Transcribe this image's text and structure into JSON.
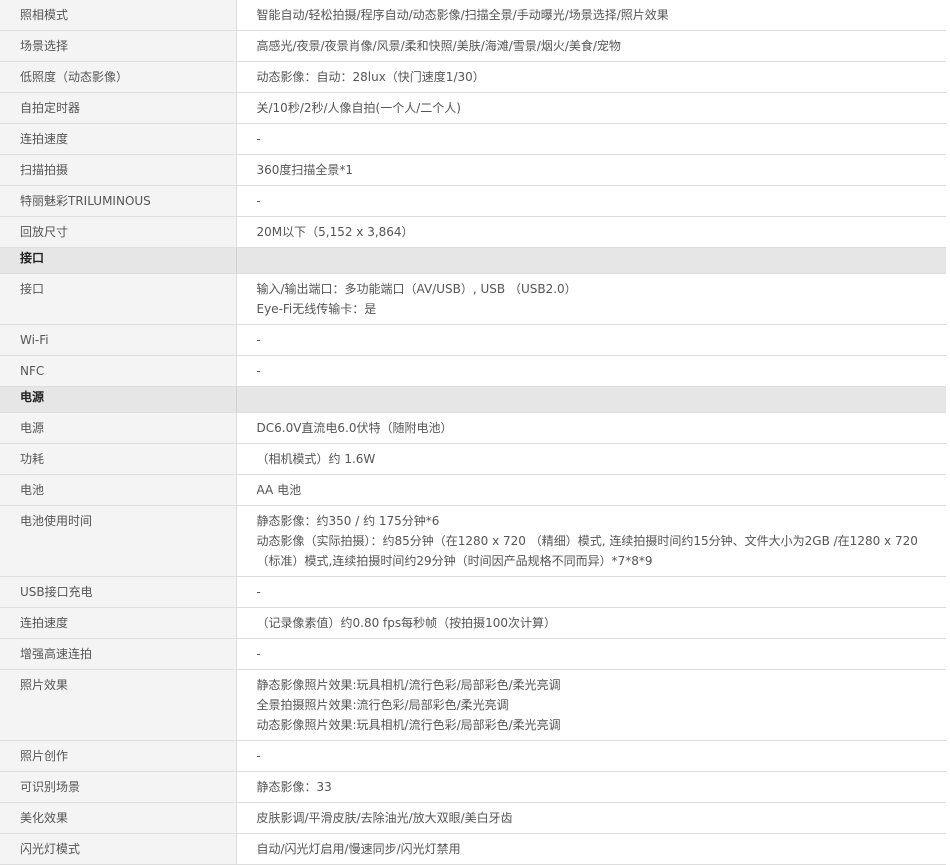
{
  "rows": [
    {
      "type": "row",
      "label": "照相模式",
      "values": [
        "智能自动/轻松拍摄/程序自动/动态影像/扫描全景/手动曝光/场景选择/照片效果"
      ]
    },
    {
      "type": "row",
      "label": "场景选择",
      "values": [
        "高感光/夜景/夜景肖像/风景/柔和快照/美肤/海滩/雪景/烟火/美食/宠物"
      ]
    },
    {
      "type": "row",
      "label": "低照度（动态影像）",
      "values": [
        "动态影像：自动：28lux（快门速度1/30）"
      ]
    },
    {
      "type": "row",
      "label": "自拍定时器",
      "values": [
        "关/10秒/2秒/人像自拍(一个人/二个人)"
      ]
    },
    {
      "type": "row",
      "label": "连拍速度",
      "values": [
        "-"
      ]
    },
    {
      "type": "row",
      "label": "扫描拍摄",
      "values": [
        "360度扫描全景*1"
      ]
    },
    {
      "type": "row",
      "label": "特丽魅彩TRILUMINOUS",
      "values": [
        "-"
      ]
    },
    {
      "type": "row",
      "label": "回放尺寸",
      "values": [
        "20M以下（5,152 x 3,864）"
      ]
    },
    {
      "type": "section",
      "label": "接口"
    },
    {
      "type": "row",
      "label": "接口",
      "values": [
        "输入/输出端口：多功能端口（AV/USB）, USB （USB2.0）",
        "Eye-Fi无线传输卡：是"
      ]
    },
    {
      "type": "row",
      "label": "Wi-Fi",
      "values": [
        "-"
      ]
    },
    {
      "type": "row",
      "label": "NFC",
      "values": [
        "-"
      ]
    },
    {
      "type": "section",
      "label": "电源"
    },
    {
      "type": "row",
      "label": "电源",
      "values": [
        "DC6.0V直流电6.0伏特（随附电池）"
      ]
    },
    {
      "type": "row",
      "label": "功耗",
      "values": [
        "（相机模式）约 1.6W"
      ]
    },
    {
      "type": "row",
      "label": "电池",
      "values": [
        "AA 电池"
      ]
    },
    {
      "type": "row",
      "label": "电池使用时间",
      "values": [
        "静态影像：约350 / 约 175分钟*6",
        "动态影像（实际拍摄）：约85分钟（在1280 x 720 （精细）模式, 连续拍摄时间约15分钟、文件大小为2GB /在1280 x  720",
        "（标准）模式,连续拍摄时间约29分钟（时间因产品规格不同而异）*7*8*9"
      ]
    },
    {
      "type": "row",
      "label": "USB接口充电",
      "values": [
        "-"
      ]
    },
    {
      "type": "row",
      "label": "连拍速度",
      "values": [
        "（记录像素值）约0.80 fps每秒帧（按拍摄100次计算）"
      ]
    },
    {
      "type": "row",
      "label": "增强高速连拍",
      "values": [
        "-"
      ]
    },
    {
      "type": "row",
      "label": "照片效果",
      "values": [
        "静态影像照片效果:玩具相机/流行色彩/局部彩色/柔光亮调",
        "全景拍摄照片效果:流行色彩/局部彩色/柔光亮调",
        "动态影像照片效果:玩具相机/流行色彩/局部彩色/柔光亮调"
      ]
    },
    {
      "type": "row",
      "label": "照片创作",
      "values": [
        "-"
      ]
    },
    {
      "type": "row",
      "label": "可识别场景",
      "values": [
        "静态影像：33"
      ]
    },
    {
      "type": "row",
      "label": "美化效果",
      "values": [
        "皮肤影调/平滑皮肤/去除油光/放大双眼/美白牙齿"
      ]
    },
    {
      "type": "row",
      "label": "闪光灯模式",
      "values": [
        "自动/闪光灯启用/慢速同步/闪光灯禁用"
      ]
    }
  ]
}
